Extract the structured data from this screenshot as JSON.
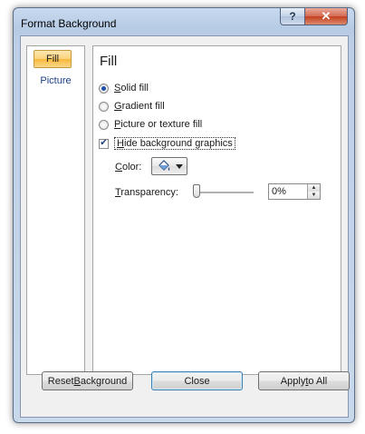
{
  "window": {
    "title": "Format Background",
    "help_glyph": "?",
    "close_glyph": "✕"
  },
  "nav": {
    "items": [
      {
        "label": "Fill",
        "selected": true
      },
      {
        "label": "Picture",
        "selected": false
      }
    ]
  },
  "fill": {
    "heading": "Fill",
    "options": [
      {
        "prefix": "",
        "underlined": "S",
        "suffix": "olid fill",
        "checked": true
      },
      {
        "prefix": "",
        "underlined": "G",
        "suffix": "radient fill",
        "checked": false
      },
      {
        "prefix": "",
        "underlined": "P",
        "suffix": "icture or texture fill",
        "checked": false
      }
    ],
    "hide_graphics": {
      "prefix": "",
      "underlined": "H",
      "suffix": "ide background graphics",
      "checked": true
    },
    "color_label_underlined": "C",
    "color_label_rest": "olor:",
    "transparency_label_underlined": "T",
    "transparency_label_rest": "ransparency:",
    "transparency_value": "0%",
    "transparency_level": 0
  },
  "buttons": {
    "reset_prefix": "Reset ",
    "reset_underlined": "B",
    "reset_suffix": "ackground",
    "close": "Close",
    "apply_prefix": "Apply ",
    "apply_underlined": "t",
    "apply_suffix": "o All"
  },
  "icons": {
    "color_button": "paint-bucket-icon",
    "dropdown": "chevron-down-icon"
  }
}
